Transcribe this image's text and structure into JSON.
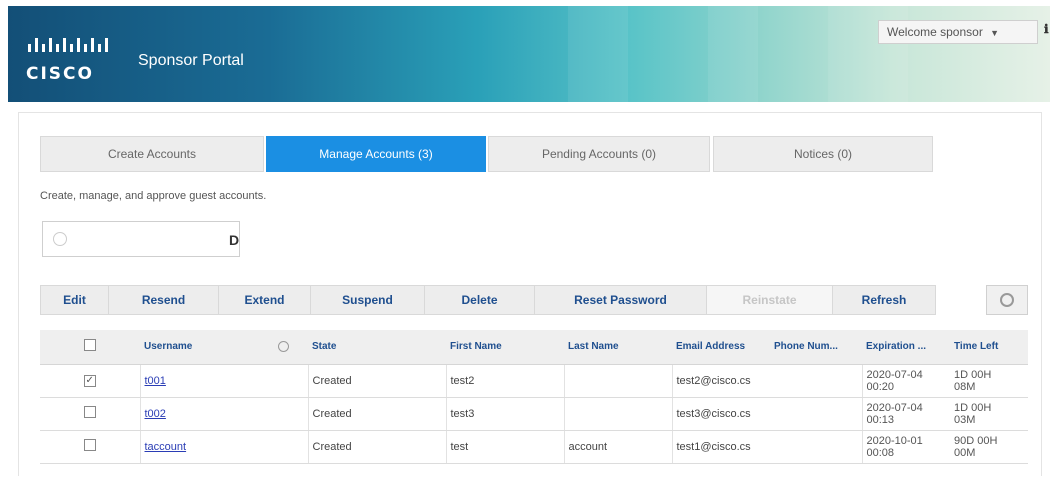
{
  "header": {
    "logo_text": "CISCO",
    "portal_title": "Sponsor Portal",
    "welcome": "Welcome sponsor",
    "info_icon": "info-icon"
  },
  "tabs": [
    {
      "label": "Create Accounts",
      "active": false
    },
    {
      "label": "Manage Accounts (3)",
      "active": true
    },
    {
      "label": "Pending Accounts (0)",
      "active": false
    },
    {
      "label": "Notices (0)",
      "active": false
    }
  ],
  "subtitle": "Create, manage, and approve guest accounts.",
  "search": {
    "value": "",
    "placeholder": "",
    "go_glyph": "D"
  },
  "toolbar": {
    "edit": "Edit",
    "resend": "Resend",
    "extend": "Extend",
    "suspend": "Suspend",
    "delete": "Delete",
    "reset_password": "Reset Password",
    "reinstate": "Reinstate",
    "refresh": "Refresh"
  },
  "table": {
    "columns": {
      "username": "Username",
      "state": "State",
      "first_name": "First Name",
      "last_name": "Last Name",
      "email": "Email Address",
      "phone": "Phone Num...",
      "expiration": "Expiration ...",
      "time_left": "Time Left"
    },
    "rows": [
      {
        "checked": true,
        "username": "t001",
        "state": "Created",
        "first_name": "test2",
        "last_name": "",
        "email": "test2@cisco.cs",
        "phone": "",
        "expiration_date": "2020-07-04",
        "expiration_time": "00:20",
        "time_left_1": "1D 00H",
        "time_left_2": "08M"
      },
      {
        "checked": false,
        "username": "t002",
        "state": "Created",
        "first_name": "test3",
        "last_name": "",
        "email": "test3@cisco.cs",
        "phone": "",
        "expiration_date": "2020-07-04",
        "expiration_time": "00:13",
        "time_left_1": "1D 00H",
        "time_left_2": "03M"
      },
      {
        "checked": false,
        "username": "taccount",
        "state": "Created",
        "first_name": "test",
        "last_name": "account",
        "email": "test1@cisco.cs",
        "phone": "",
        "expiration_date": "2020-10-01",
        "expiration_time": "00:08",
        "time_left_1": "90D 00H",
        "time_left_2": "00M"
      }
    ]
  }
}
